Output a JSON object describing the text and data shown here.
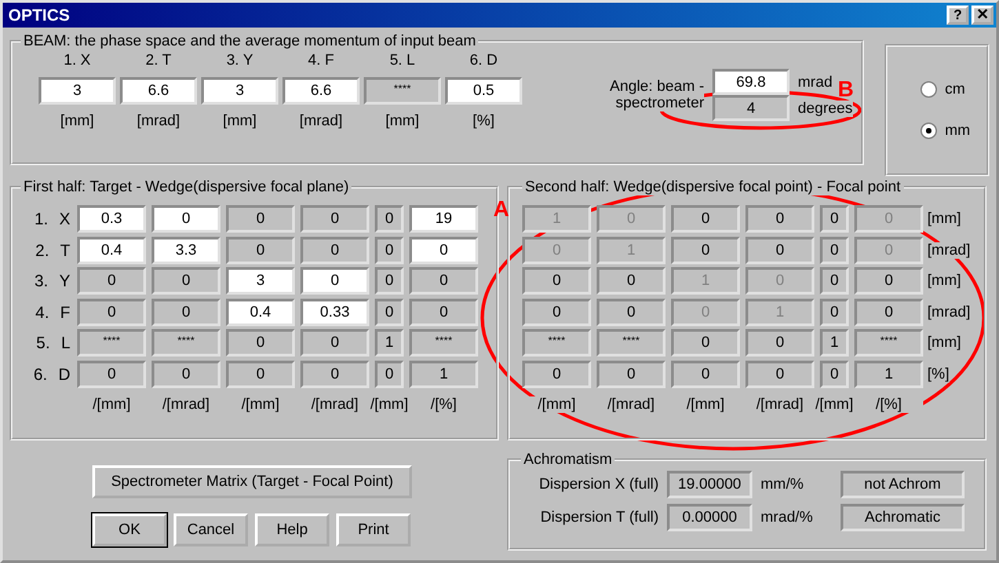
{
  "window": {
    "title": "OPTICS",
    "buttons": [
      {
        "kind": "help",
        "label": "?"
      },
      {
        "kind": "close",
        "label": "✕"
      }
    ]
  },
  "beam": {
    "title": "BEAM:  the phase space and the average momentum of input beam",
    "fields": [
      {
        "label": "1. X",
        "value": "3",
        "unit": "[mm]",
        "editable": true
      },
      {
        "label": "2. T",
        "value": "6.6",
        "unit": "[mrad]",
        "editable": true
      },
      {
        "label": "3. Y",
        "value": "3",
        "unit": "[mm]",
        "editable": true
      },
      {
        "label": "4. F",
        "value": "6.6",
        "unit": "[mrad]",
        "editable": true
      },
      {
        "label": "5. L",
        "value": "****",
        "unit": "[mm]",
        "editable": false
      },
      {
        "label": "6. D",
        "value": "0.5",
        "unit": "[%]",
        "editable": true
      }
    ],
    "angle": {
      "label": "Angle: beam - spectrometer",
      "values": [
        {
          "value": "69.8",
          "unit": "mrad",
          "editable": true
        },
        {
          "value": "4",
          "unit": "degrees",
          "editable": false
        }
      ]
    }
  },
  "units": [
    {
      "label": "cm",
      "selected": false
    },
    {
      "label": "mm",
      "selected": true
    }
  ],
  "first_half": {
    "title": "First half: Target - Wedge(dispersive focal plane)",
    "row_labels": [
      {
        "index": "1.",
        "axis": "X"
      },
      {
        "index": "2.",
        "axis": "T"
      },
      {
        "index": "3.",
        "axis": "Y"
      },
      {
        "index": "4.",
        "axis": "F"
      },
      {
        "index": "5.",
        "axis": "L"
      },
      {
        "index": "6.",
        "axis": "D"
      }
    ],
    "rows": [
      [
        {
          "v": "0.3",
          "editable": true,
          "dim": false
        },
        {
          "v": "0",
          "editable": true,
          "dim": false
        },
        {
          "v": "0",
          "editable": false,
          "dim": false
        },
        {
          "v": "0",
          "editable": false,
          "dim": false
        },
        {
          "v": "0",
          "editable": false,
          "dim": false
        },
        {
          "v": "19",
          "editable": true,
          "dim": false
        }
      ],
      [
        {
          "v": "0.4",
          "editable": true,
          "dim": false
        },
        {
          "v": "3.3",
          "editable": true,
          "dim": false
        },
        {
          "v": "0",
          "editable": false,
          "dim": false
        },
        {
          "v": "0",
          "editable": false,
          "dim": false
        },
        {
          "v": "0",
          "editable": false,
          "dim": false
        },
        {
          "v": "0",
          "editable": true,
          "dim": false
        }
      ],
      [
        {
          "v": "0",
          "editable": false,
          "dim": false
        },
        {
          "v": "0",
          "editable": false,
          "dim": false
        },
        {
          "v": "3",
          "editable": true,
          "dim": false
        },
        {
          "v": "0",
          "editable": true,
          "dim": false
        },
        {
          "v": "0",
          "editable": false,
          "dim": false
        },
        {
          "v": "0",
          "editable": false,
          "dim": false
        }
      ],
      [
        {
          "v": "0",
          "editable": false,
          "dim": false
        },
        {
          "v": "0",
          "editable": false,
          "dim": false
        },
        {
          "v": "0.4",
          "editable": true,
          "dim": false
        },
        {
          "v": "0.33",
          "editable": true,
          "dim": false
        },
        {
          "v": "0",
          "editable": false,
          "dim": false
        },
        {
          "v": "0",
          "editable": false,
          "dim": false
        }
      ],
      [
        {
          "v": "****",
          "editable": false,
          "dim": false
        },
        {
          "v": "****",
          "editable": false,
          "dim": false
        },
        {
          "v": "0",
          "editable": false,
          "dim": false
        },
        {
          "v": "0",
          "editable": false,
          "dim": false
        },
        {
          "v": "1",
          "editable": false,
          "dim": false
        },
        {
          "v": "****",
          "editable": false,
          "dim": false
        }
      ],
      [
        {
          "v": "0",
          "editable": false,
          "dim": false
        },
        {
          "v": "0",
          "editable": false,
          "dim": false
        },
        {
          "v": "0",
          "editable": false,
          "dim": false
        },
        {
          "v": "0",
          "editable": false,
          "dim": false
        },
        {
          "v": "0",
          "editable": false,
          "dim": false
        },
        {
          "v": "1",
          "editable": false,
          "dim": false
        }
      ]
    ],
    "column_units": [
      "/[mm]",
      "/[mrad]",
      "/[mm]",
      "/[mrad]",
      "/[mm]",
      "/[%]"
    ]
  },
  "second_half": {
    "title": "Second half: Wedge(dispersive focal point) - Focal point",
    "rows": [
      [
        {
          "v": "1",
          "editable": false,
          "dim": true
        },
        {
          "v": "0",
          "editable": false,
          "dim": true
        },
        {
          "v": "0",
          "editable": false,
          "dim": false
        },
        {
          "v": "0",
          "editable": false,
          "dim": false
        },
        {
          "v": "0",
          "editable": false,
          "dim": false
        },
        {
          "v": "0",
          "editable": false,
          "dim": true
        }
      ],
      [
        {
          "v": "0",
          "editable": false,
          "dim": true
        },
        {
          "v": "1",
          "editable": false,
          "dim": true
        },
        {
          "v": "0",
          "editable": false,
          "dim": false
        },
        {
          "v": "0",
          "editable": false,
          "dim": false
        },
        {
          "v": "0",
          "editable": false,
          "dim": false
        },
        {
          "v": "0",
          "editable": false,
          "dim": true
        }
      ],
      [
        {
          "v": "0",
          "editable": false,
          "dim": false
        },
        {
          "v": "0",
          "editable": false,
          "dim": false
        },
        {
          "v": "1",
          "editable": false,
          "dim": true
        },
        {
          "v": "0",
          "editable": false,
          "dim": true
        },
        {
          "v": "0",
          "editable": false,
          "dim": false
        },
        {
          "v": "0",
          "editable": false,
          "dim": false
        }
      ],
      [
        {
          "v": "0",
          "editable": false,
          "dim": false
        },
        {
          "v": "0",
          "editable": false,
          "dim": false
        },
        {
          "v": "0",
          "editable": false,
          "dim": true
        },
        {
          "v": "1",
          "editable": false,
          "dim": true
        },
        {
          "v": "0",
          "editable": false,
          "dim": false
        },
        {
          "v": "0",
          "editable": false,
          "dim": false
        }
      ],
      [
        {
          "v": "****",
          "editable": false,
          "dim": false
        },
        {
          "v": "****",
          "editable": false,
          "dim": false
        },
        {
          "v": "0",
          "editable": false,
          "dim": false
        },
        {
          "v": "0",
          "editable": false,
          "dim": false
        },
        {
          "v": "1",
          "editable": false,
          "dim": false
        },
        {
          "v": "****",
          "editable": false,
          "dim": false
        }
      ],
      [
        {
          "v": "0",
          "editable": false,
          "dim": false
        },
        {
          "v": "0",
          "editable": false,
          "dim": false
        },
        {
          "v": "0",
          "editable": false,
          "dim": false
        },
        {
          "v": "0",
          "editable": false,
          "dim": false
        },
        {
          "v": "0",
          "editable": false,
          "dim": false
        },
        {
          "v": "1",
          "editable": false,
          "dim": false
        }
      ]
    ],
    "row_units": [
      "[mm]",
      "[mrad]",
      "[mm]",
      "[mrad]",
      "[mm]",
      "[%]"
    ],
    "column_units": [
      "/[mm]",
      "/[mrad]",
      "/[mm]",
      "/[mrad]",
      "/[mm]",
      "/[%]"
    ]
  },
  "spectrometer_button": "Spectrometer Matrix (Target - Focal Point)",
  "buttons": [
    {
      "label": "OK",
      "default": true
    },
    {
      "label": "Cancel",
      "default": false
    },
    {
      "label": "Help",
      "default": false
    },
    {
      "label": "Print",
      "default": false
    }
  ],
  "achromatism": {
    "title": "Achromatism",
    "rows": [
      {
        "label": "Dispersion X (full)",
        "value": "19.00000",
        "unit": "mm/%",
        "status": "not Achrom"
      },
      {
        "label": "Dispersion T (full)",
        "value": "0.00000",
        "unit": "mrad/%",
        "status": "Achromatic"
      }
    ]
  },
  "annotations": [
    {
      "label": "A"
    },
    {
      "label": "B"
    }
  ]
}
